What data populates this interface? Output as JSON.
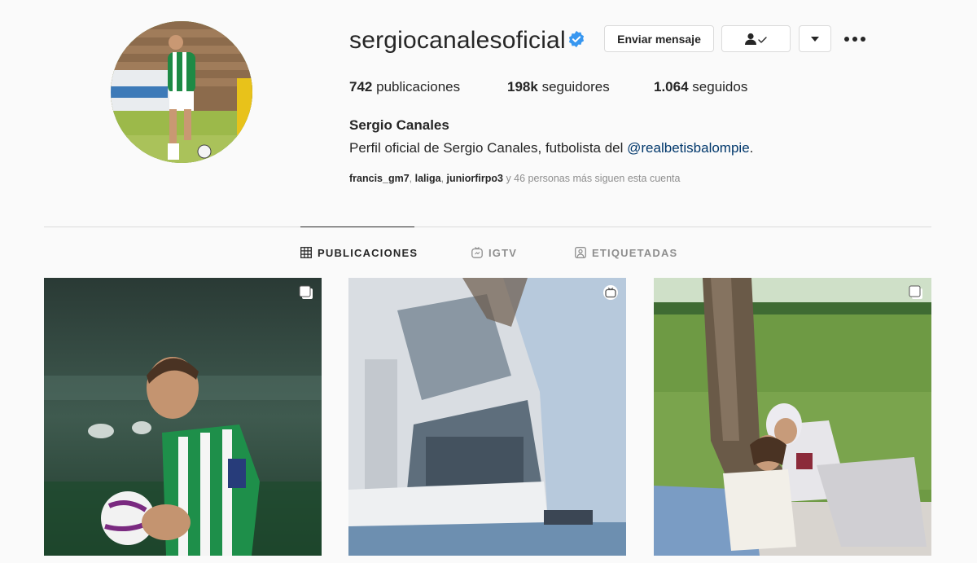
{
  "profile": {
    "username": "sergiocanalesoficial",
    "verified": true,
    "full_name": "Sergio Canales",
    "bio_text": "Perfil oficial de Sergio Canales, futbolista del ",
    "bio_mention": "@realbetisbalompie",
    "bio_suffix": ".",
    "stats": {
      "posts_value": "742",
      "posts_label": "publicaciones",
      "followers_value": "198k",
      "followers_label": "seguidores",
      "following_value": "1.064",
      "following_label": "seguidos"
    },
    "followed_by": {
      "users": [
        "francis_gm7",
        "laliga",
        "juniorfirpo3"
      ],
      "sep": ", ",
      "suffix": " y 46 personas más siguen esta cuenta"
    }
  },
  "actions": {
    "message_label": "Enviar mensaje",
    "follow_icon": "user-check-icon",
    "dropdown_icon": "caret-down-icon",
    "more_icon": "ellipsis-icon"
  },
  "tabs": [
    {
      "label": "PUBLICACIONES",
      "icon": "grid-icon",
      "active": true
    },
    {
      "label": "IGTV",
      "icon": "igtv-icon",
      "active": false
    },
    {
      "label": "ETIQUETADAS",
      "icon": "tagged-icon",
      "active": false
    }
  ],
  "posts": [
    {
      "badge": "carousel-icon"
    },
    {
      "badge": "igtv-icon"
    },
    {
      "badge": "carousel-icon"
    }
  ],
  "colors": {
    "background": "#fafafa",
    "text": "#262626",
    "muted": "#8e8e8e",
    "link": "#00376b",
    "verified": "#3897f0",
    "border": "#dbdbdb"
  }
}
